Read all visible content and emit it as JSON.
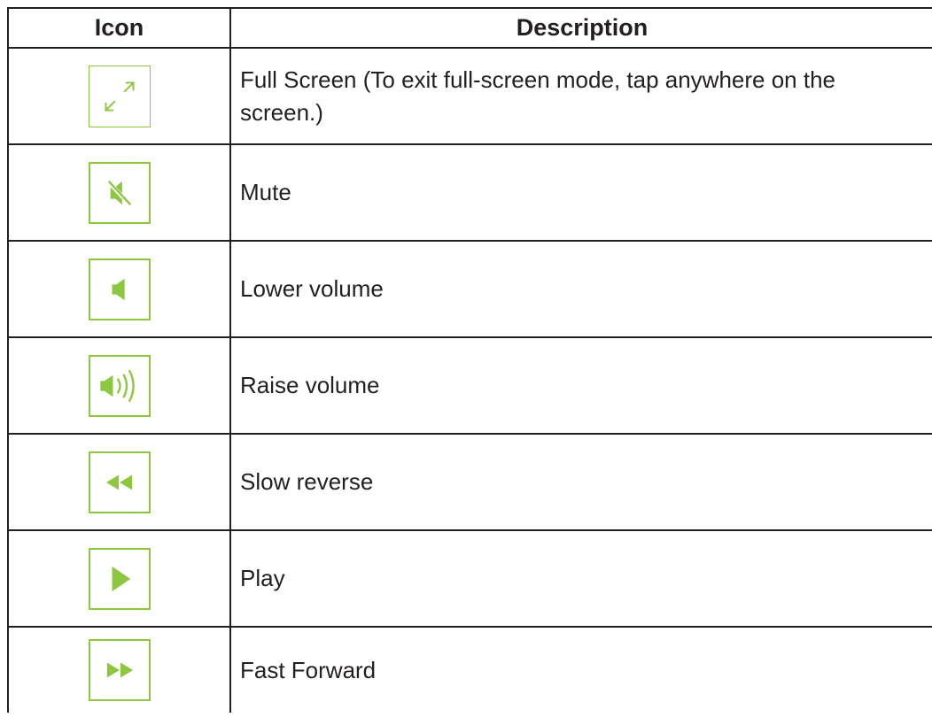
{
  "table": {
    "headers": {
      "icon": "Icon",
      "description": "Description"
    },
    "rows": [
      {
        "icon": "full-screen-icon",
        "description": "Full Screen (To exit full-screen mode, tap anywhere on the screen.)"
      },
      {
        "icon": "mute-icon",
        "description": "Mute"
      },
      {
        "icon": "lower-volume-icon",
        "description": "Lower volume"
      },
      {
        "icon": "raise-volume-icon",
        "description": "Raise volume"
      },
      {
        "icon": "slow-reverse-icon",
        "description": "Slow reverse"
      },
      {
        "icon": "play-icon",
        "description": "Play"
      },
      {
        "icon": "fast-forward-icon",
        "description": "Fast Forward"
      }
    ]
  },
  "colors": {
    "icon_accent": "#8dc63f",
    "text": "#231f20",
    "border": "#231f20"
  }
}
